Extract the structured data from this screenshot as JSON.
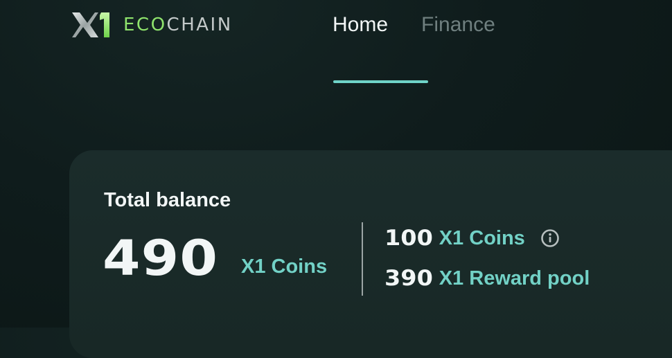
{
  "header": {
    "logo": {
      "mark_icon": "x1-logo-mark",
      "word_eco": "ECO",
      "word_chain": "CHAIN"
    },
    "nav": {
      "tabs": [
        {
          "label": "Home",
          "active": true
        },
        {
          "label": "Finance",
          "active": false
        }
      ]
    }
  },
  "balance": {
    "title": "Total balance",
    "total_amount": "490",
    "total_unit": "X1 Coins",
    "breakdown": [
      {
        "amount": "100",
        "unit": "X1 Coins",
        "icon": "info-icon"
      },
      {
        "amount": "390",
        "unit": "X1 Reward pool"
      }
    ]
  },
  "colors": {
    "background": "#0f1c1c",
    "card": "#1a2b2a",
    "accent_teal": "#72d1c6",
    "logo_green": "#8fe36c",
    "logo_gray": "#c3c9c9",
    "text_primary": "#f2f6f6",
    "text_muted": "#6f7f7f"
  }
}
